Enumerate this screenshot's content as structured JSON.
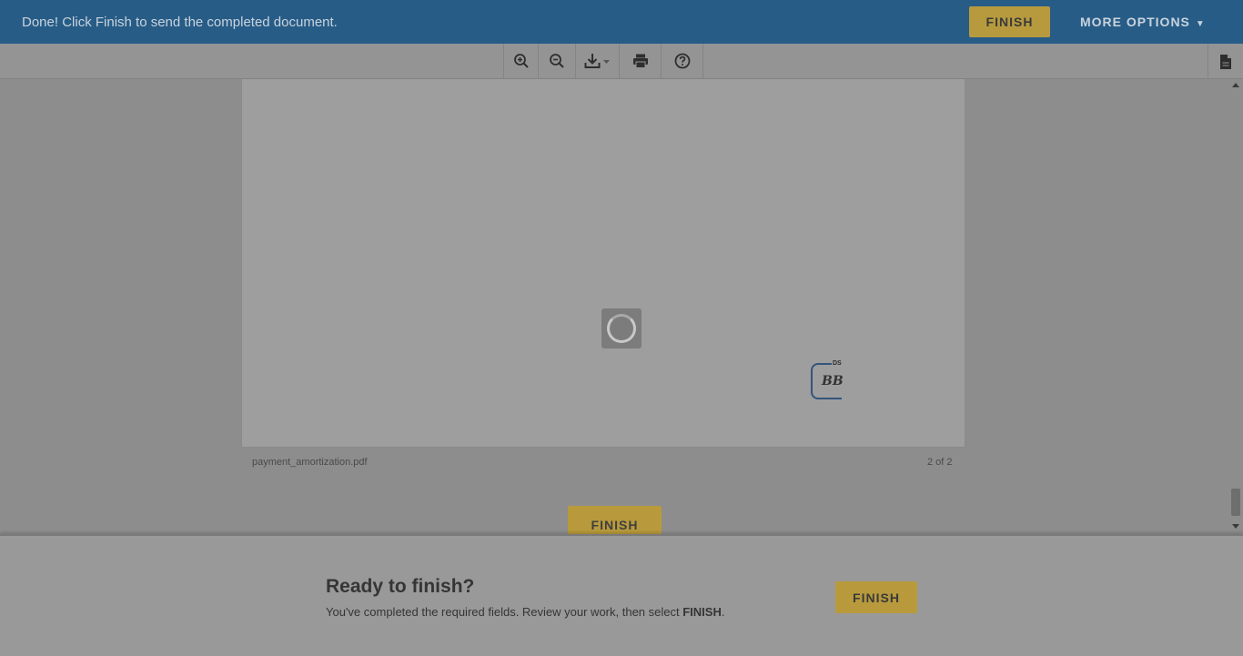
{
  "banner": {
    "message": "Done! Click Finish to send the completed document.",
    "finish_label": "FINISH",
    "more_options_label": "MORE OPTIONS",
    "more_options_caret": "▼"
  },
  "toolbar": {
    "tools": [
      "zoom-in-icon",
      "zoom-out-icon",
      "download-icon",
      "print-icon",
      "help-icon"
    ],
    "right_icon": "document-icon"
  },
  "document": {
    "filename": "payment_amortization.pdf",
    "page_indicator": "2 of 2",
    "initials_tag": "DS",
    "initials": "BB",
    "inline_finish_label": "FINISH"
  },
  "bottom_panel": {
    "title": "Ready to finish?",
    "desc_prefix": "You've completed the required fields. Review your work, then select ",
    "desc_emphasis": "FINISH",
    "desc_suffix": ".",
    "finish_label": "FINISH"
  },
  "colors": {
    "banner_bg": "#275c87",
    "finish_bg": "#b89a3c",
    "initials_border": "#33557a"
  }
}
